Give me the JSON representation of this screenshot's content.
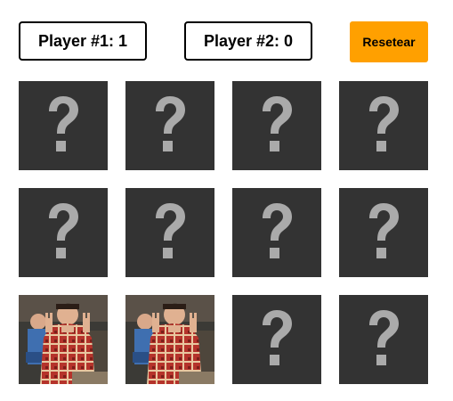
{
  "scoreboard": {
    "player1": "Player #1: 1",
    "player2": "Player #2: 0",
    "reset_label": "Resetear"
  },
  "colors": {
    "card_back": "#333333",
    "question_mark": "#aaaaaa",
    "reset_button": "#ffa000"
  },
  "board": {
    "cards": [
      {
        "state": "hidden",
        "icon": "question-mark-icon"
      },
      {
        "state": "hidden",
        "icon": "question-mark-icon"
      },
      {
        "state": "hidden",
        "icon": "question-mark-icon"
      },
      {
        "state": "hidden",
        "icon": "question-mark-icon"
      },
      {
        "state": "hidden",
        "icon": "question-mark-icon"
      },
      {
        "state": "hidden",
        "icon": "question-mark-icon"
      },
      {
        "state": "hidden",
        "icon": "question-mark-icon"
      },
      {
        "state": "hidden",
        "icon": "question-mark-icon"
      },
      {
        "state": "revealed",
        "icon": "joey-image"
      },
      {
        "state": "revealed",
        "icon": "joey-image"
      },
      {
        "state": "hidden",
        "icon": "question-mark-icon"
      },
      {
        "state": "hidden",
        "icon": "question-mark-icon"
      }
    ]
  }
}
